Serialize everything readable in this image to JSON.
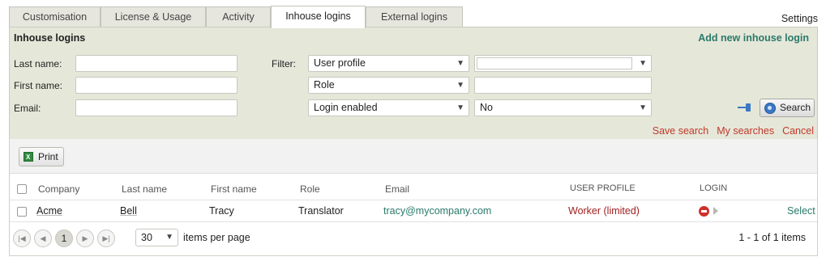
{
  "tabs": [
    "Customisation",
    "License & Usage",
    "Activity",
    "Inhouse logins",
    "External logins"
  ],
  "active_tab": "Inhouse logins",
  "settings_label": "Settings",
  "panel": {
    "title": "Inhouse logins",
    "add_link": "Add new inhouse login",
    "labels": {
      "last_name": "Last name:",
      "first_name": "First name:",
      "email": "Email:",
      "filter": "Filter:"
    },
    "filters": [
      {
        "field": "User profile",
        "value": ""
      },
      {
        "field": "Role",
        "value": ""
      },
      {
        "field": "Login enabled",
        "value": "No"
      }
    ],
    "search_button": "Search",
    "links": {
      "save_search": "Save search",
      "my_searches": "My searches",
      "cancel": "Cancel"
    }
  },
  "grid": {
    "print_button": "Print",
    "columns": [
      "Company",
      "Last name",
      "First name",
      "Role",
      "Email",
      "USER PROFILE",
      "LOGIN"
    ],
    "rows": [
      {
        "company": "Acme",
        "last_name": "Bell",
        "first_name": "Tracy",
        "role": "Translator",
        "email": "tracy@mycompany.com",
        "user_profile": "Worker (limited)",
        "action": "Select"
      }
    ],
    "pager": {
      "current_page": "1",
      "per_page": "30",
      "per_page_label": "items per page",
      "count_text": "1 - 1 of 1 items"
    }
  },
  "colors": {
    "panel_bg": "#e5e7d9",
    "accent_green": "#2a7a6a",
    "link_red": "#c0392b",
    "profile_red": "#a02020"
  },
  "icons": [
    "excel-icon",
    "search-icon",
    "pin-icon",
    "login-disabled-icon",
    "expand-arrow-icon",
    "first-page-icon",
    "prev-page-icon",
    "next-page-icon",
    "last-page-icon",
    "chevron-down-icon"
  ]
}
